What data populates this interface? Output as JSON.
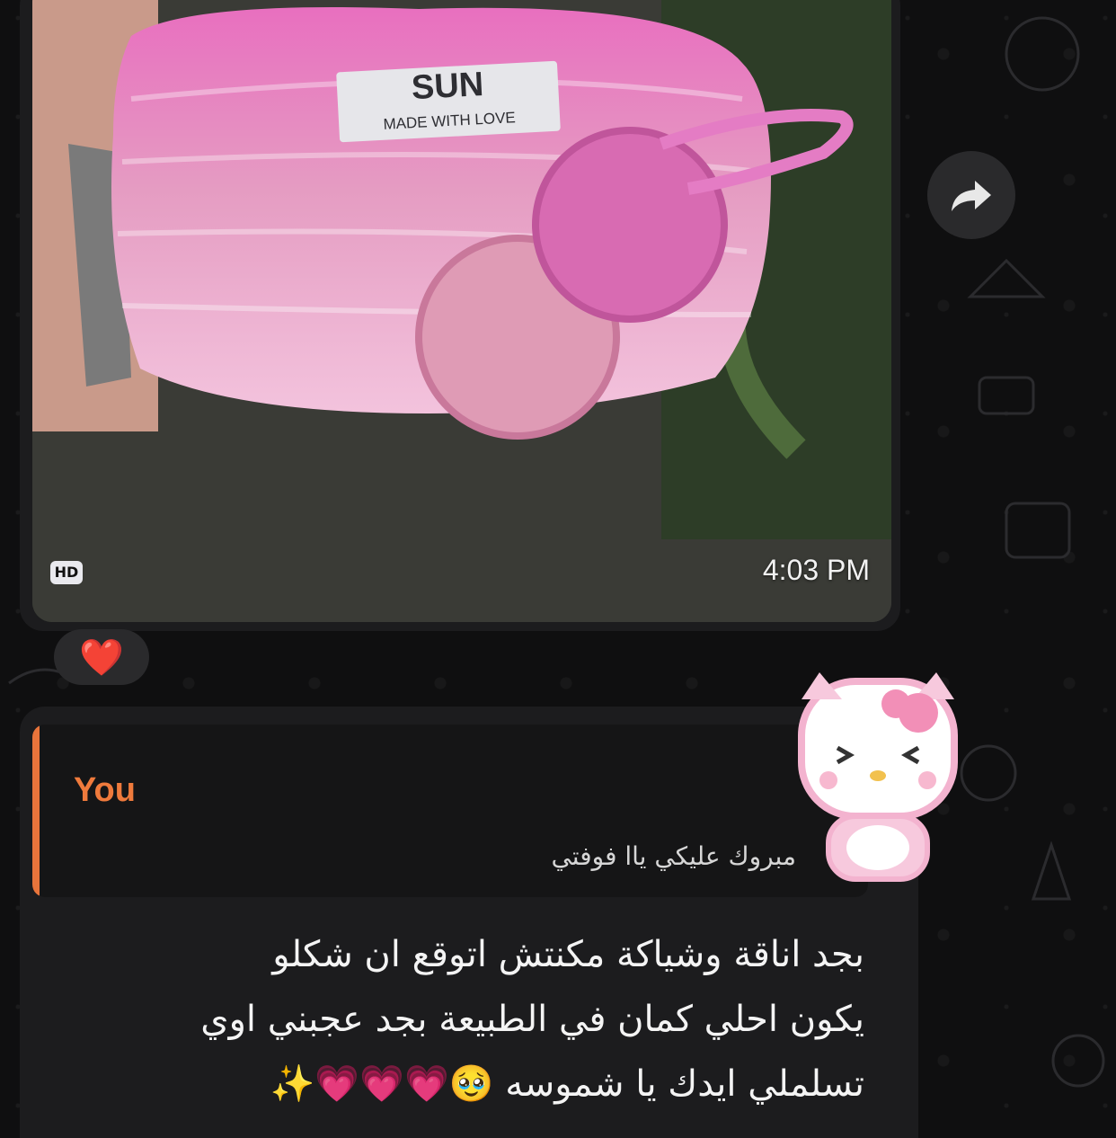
{
  "photo_message": {
    "label_brand": "SUN",
    "label_tagline": "MADE WITH LOVE",
    "quality_badge": "HD",
    "time": "4:03 PM"
  },
  "reaction": {
    "emoji": "❤️"
  },
  "reply_message": {
    "quoted_author": "You",
    "quoted_text": "مبروك عليكي ياا فوفتي",
    "lines": [
      "بجد اناقة وشياكة مكنتش اتوقع ان شكلو",
      "يكون احلي كمان في الطبيعة بجد عجبني اوي",
      "تسلملي ايدك يا شموسه 🥹💗💗💗✨"
    ]
  },
  "colors": {
    "background": "#0f0f10",
    "bubble": "#1c1c1e",
    "quote_accent": "#e8743b",
    "text": "#f4f4f4"
  },
  "icons": [
    "forward-arrow-icon",
    "heart-reaction-icon",
    "hello-kitty-sticker"
  ]
}
